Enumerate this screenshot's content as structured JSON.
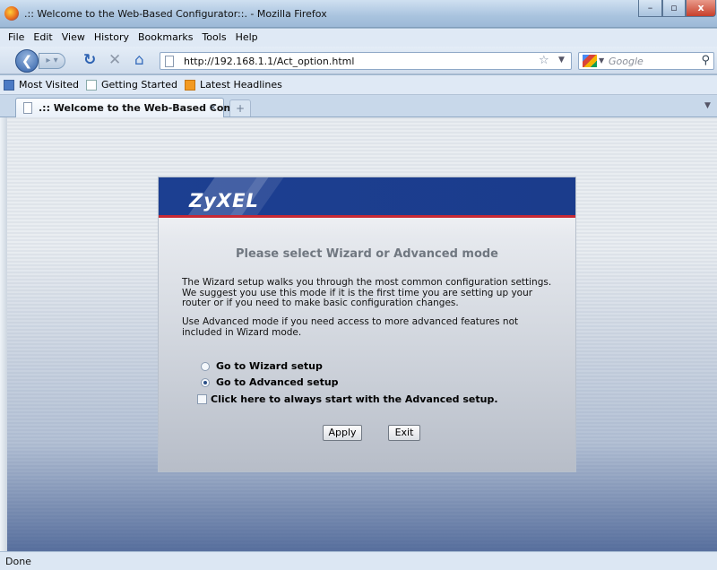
{
  "window": {
    "title": ".:: Welcome to the Web-Based Configurator::. - Mozilla Firefox",
    "min": "–",
    "max": "▫",
    "close": "x"
  },
  "menu": [
    "File",
    "Edit",
    "View",
    "History",
    "Bookmarks",
    "Tools",
    "Help"
  ],
  "nav": {
    "url": "http://192.168.1.1/Act_option.html",
    "search_placeholder": "Google"
  },
  "bookmarks": [
    {
      "label": "Most Visited",
      "icon": "most-visited-icon"
    },
    {
      "label": "Getting Started",
      "icon": "page-icon"
    },
    {
      "label": "Latest Headlines",
      "icon": "rss-icon"
    }
  ],
  "tab": {
    "label": ".:: Welcome to the Web-Based Confi..."
  },
  "page": {
    "logo": "ZyXEL",
    "heading": "Please select Wizard or Advanced mode",
    "para1": "The Wizard setup walks you through the most common configuration settings. We suggest you use this mode if it is the first time you are setting up your router or if you need to make basic configuration changes.",
    "para2": "Use Advanced mode if you need access to more advanced features not included in Wizard mode.",
    "option_wizard": "Go to Wizard setup",
    "option_advanced": "Go to Advanced setup",
    "selected_option": "Go to Advanced setup",
    "always_advanced": "Click here to always start with the Advanced setup.",
    "always_advanced_checked": false,
    "apply": "Apply",
    "exit": "Exit"
  },
  "status": "Done",
  "colors": {
    "banner": "#1c3f91",
    "banner_accent": "#c82a35"
  }
}
